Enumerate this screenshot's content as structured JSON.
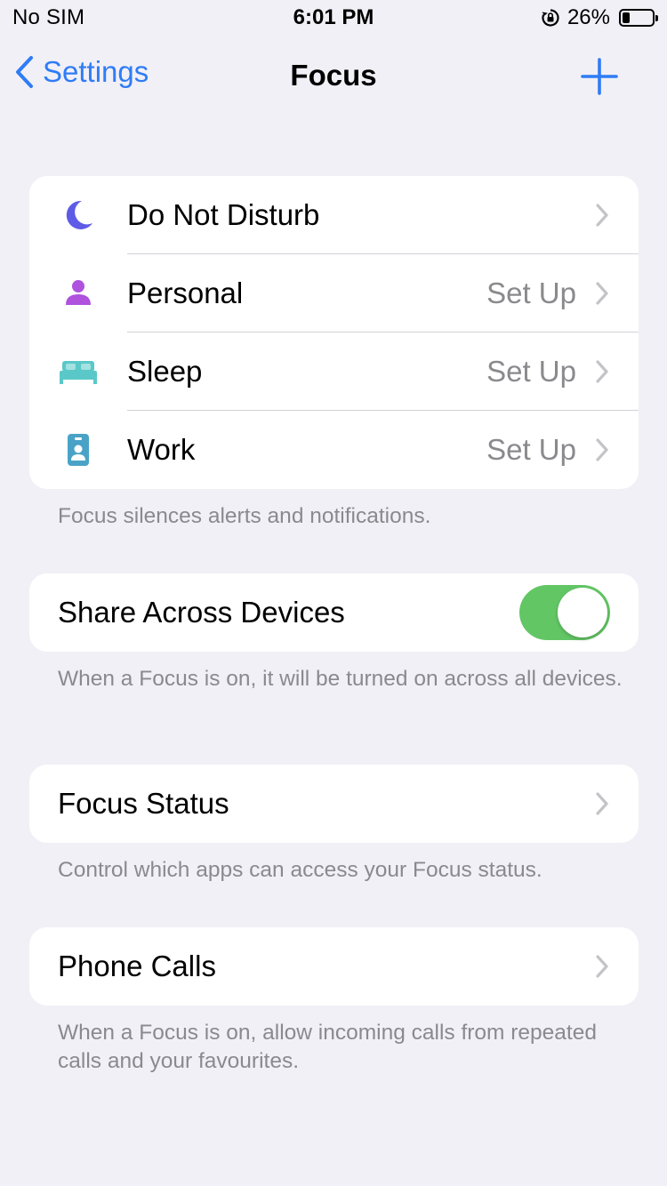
{
  "status_bar": {
    "carrier": "No SIM",
    "time": "6:01 PM",
    "battery_text": "26%",
    "battery_level": 0.26
  },
  "nav": {
    "back_label": "Settings",
    "title": "Focus"
  },
  "focus_modes": [
    {
      "label": "Do Not Disturb",
      "value": "",
      "icon": "moon-icon",
      "color": "#5e5ce6"
    },
    {
      "label": "Personal",
      "value": "Set Up",
      "icon": "person-icon",
      "color": "#af52de"
    },
    {
      "label": "Sleep",
      "value": "Set Up",
      "icon": "bed-icon",
      "color": "#5ac8c8"
    },
    {
      "label": "Work",
      "value": "Set Up",
      "icon": "id-badge-icon",
      "color": "#4aa3c7"
    }
  ],
  "focus_modes_footnote": "Focus silences alerts and notifications.",
  "share": {
    "label": "Share Across Devices",
    "enabled": true,
    "footnote": "When a Focus is on, it will be turned on across all devices."
  },
  "focus_status": {
    "label": "Focus Status",
    "footnote": "Control which apps can access your Focus status."
  },
  "phone_calls": {
    "label": "Phone Calls",
    "footnote": "When a Focus is on, allow incoming calls from repeated calls and your favourites."
  },
  "colors": {
    "accent": "#2f7cf6",
    "toggle_on": "#63c665",
    "background": "#f1f0f6"
  }
}
